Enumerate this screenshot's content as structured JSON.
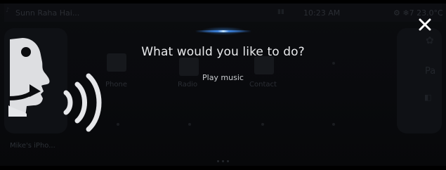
{
  "status": {
    "track": "Sunn Raha Hai...",
    "time": "10:23 AM",
    "right": "⚙ ❄7  23.0°C"
  },
  "apps": {
    "phone": "Phone",
    "radio": "Radio",
    "contact": "Contact"
  },
  "device": {
    "label": "Mike's iPho..."
  },
  "right_panel": {
    "partial": "Pa"
  },
  "voice": {
    "prompt": "What would you like to do?",
    "suggestion": "Play music"
  },
  "icons": {
    "close": "close-icon",
    "voice": "voice-assistant-icon",
    "settings": "gear-icon"
  },
  "colors": {
    "background": "#0a0b0e",
    "accent_glow": "#3b7fd8",
    "prompt_text": "#e9eaec"
  }
}
